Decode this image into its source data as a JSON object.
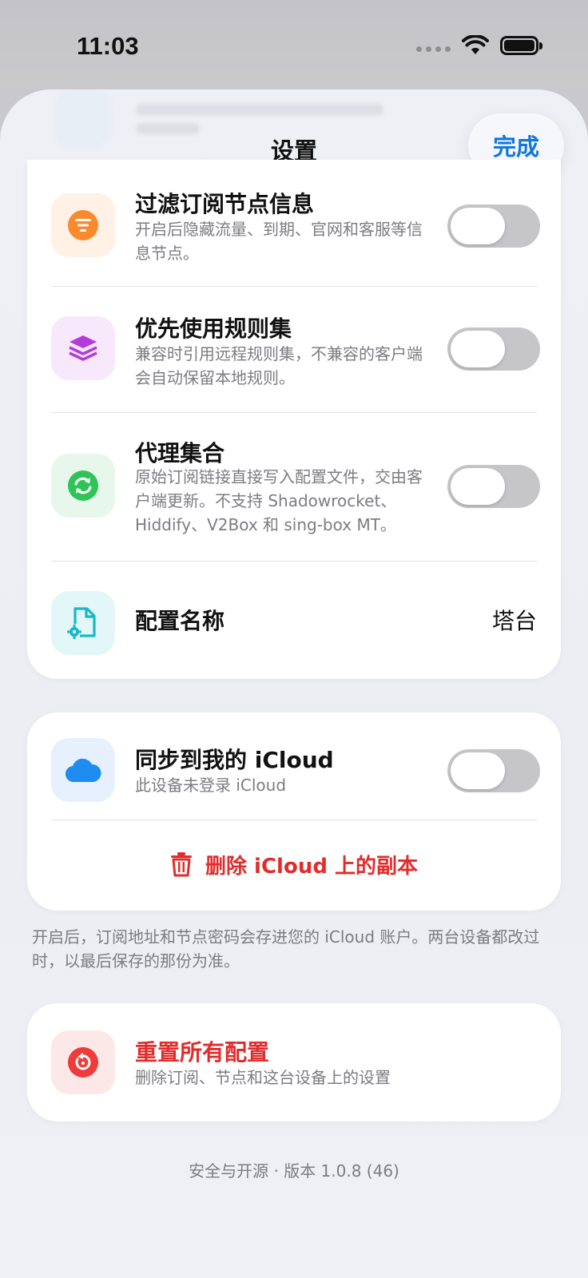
{
  "status_bar": {
    "time": "11:03"
  },
  "nav": {
    "title": "设置",
    "done_label": "完成"
  },
  "settings": {
    "filter": {
      "title": "过滤订阅节点信息",
      "subtitle": "开启后隐藏流量、到期、官网和客服等信息节点。",
      "enabled": false,
      "icon_color": "#fb8a2c",
      "icon_bg": "#fff1e6"
    },
    "prefer_rules": {
      "title": "优先使用规则集",
      "subtitle": "兼容时引用远程规则集，不兼容的客户端会自动保留本地规则。",
      "enabled": false,
      "icon_color": "#b43bd8",
      "icon_bg": "#f8e8fb"
    },
    "proxy_set": {
      "title": "代理集合",
      "subtitle": "原始订阅链接直接写入配置文件，交由客户端更新。不支持 Shadowrocket、Hiddify、V2Box 和 sing-box MT。",
      "enabled": false,
      "icon_color": "#2fc456",
      "icon_bg": "#e8f7ec"
    },
    "config_name": {
      "title": "配置名称",
      "value": "塔台",
      "icon_color": "#17b8c8",
      "icon_bg": "#e4f7f8"
    }
  },
  "icloud": {
    "title": "同步到我的 iCloud",
    "subtitle": "此设备未登录 iCloud",
    "enabled": false,
    "icon_color": "#1e8cf0",
    "icon_bg": "#e6f1fd",
    "delete_label": "删除 iCloud 上的副本",
    "footnote": "开启后，订阅地址和节点密码会存进您的 iCloud 账户。两台设备都改过时，以最后保存的那份为准。"
  },
  "reset": {
    "title": "重置所有配置",
    "subtitle": "删除订阅、节点和这台设备上的设置",
    "icon_color": "#ef3b3b",
    "icon_bg": "#fde8e8"
  },
  "footer": {
    "version_text": "安全与开源 · 版本 1.0.8 (46)"
  },
  "colors": {
    "accent": "#1477e0",
    "danger": "#e12c2c",
    "toggle_off": "#c6c6c8"
  }
}
